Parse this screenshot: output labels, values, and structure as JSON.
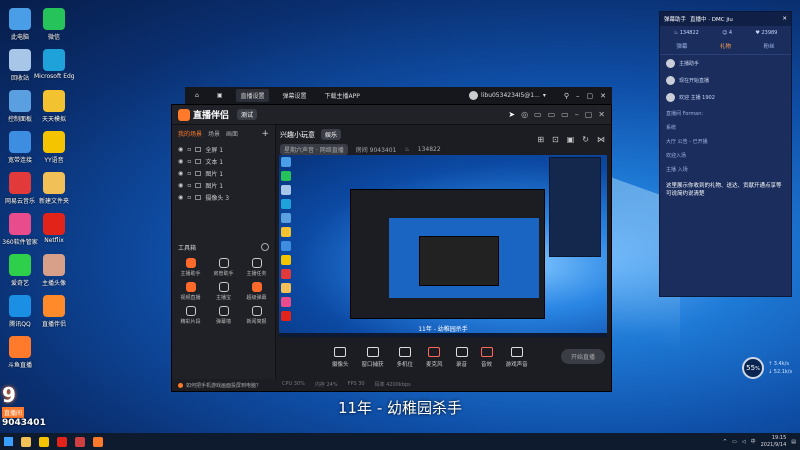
{
  "desktop_icons": [
    {
      "label": "此电脑",
      "color": "#4a9ee8"
    },
    {
      "label": "微信",
      "color": "#25c35a"
    },
    {
      "label": "回收站",
      "color": "#a8c6e8"
    },
    {
      "label": "Microsoft Edge",
      "color": "#1fa2d9"
    },
    {
      "label": "控制面板",
      "color": "#5aa0e0"
    },
    {
      "label": "天天模拟",
      "color": "#f2c230"
    },
    {
      "label": "宽带连接",
      "color": "#3d8de0"
    },
    {
      "label": "YY语音",
      "color": "#f5c400"
    },
    {
      "label": "网易云音乐",
      "color": "#e23a3a"
    },
    {
      "label": "新建文件夹",
      "color": "#f1c056"
    },
    {
      "label": "360软件管家",
      "color": "#e94c8c"
    },
    {
      "label": "Netflix",
      "color": "#e2231a"
    },
    {
      "label": "爱奇艺",
      "color": "#2ecf4a"
    },
    {
      "label": "主播头像",
      "color": "#d9a089"
    },
    {
      "label": "腾讯QQ",
      "color": "#1a8fe3"
    },
    {
      "label": "直播伴侣",
      "color": "#ff8a2a"
    },
    {
      "label": "斗鱼直播",
      "color": "#ff7a2b"
    }
  ],
  "top_bar": {
    "items": [
      "直播设置",
      "弹幕设置",
      "下载主播APP"
    ],
    "user": "libu0534234I5@1..."
  },
  "app": {
    "logo": "直播伴侣",
    "version": "测试",
    "panel_tabs": [
      "我的场景",
      "场景",
      "画面"
    ],
    "sources": [
      "全屏 1",
      "文本 1",
      "图片 1",
      "图片 1",
      "摄像头 3"
    ],
    "tools_title": "工具箱",
    "tools": [
      {
        "label": "主播助手",
        "hot": true
      },
      {
        "label": "房管助手",
        "hot": false
      },
      {
        "label": "主播任务",
        "hot": false
      },
      {
        "label": "视频直播",
        "hot": true
      },
      {
        "label": "主播宝",
        "hot": false
      },
      {
        "label": "超级弹幕",
        "hot": true
      },
      {
        "label": "精彩片段",
        "hot": false
      },
      {
        "label": "弹幕墙",
        "hot": false
      },
      {
        "label": "新闻简报",
        "hot": false
      }
    ],
    "tip": "如何把手机游戏画面投屏到电脑？",
    "room_title": "兴趣小玩意",
    "room_tag": "娱乐",
    "meta_category": "星期六声音 · 网络直播",
    "meta_room": "房间 9043401",
    "meta_hot": "134822",
    "controls": [
      "摄像头",
      "窗口捕获",
      "多机位",
      "麦克风",
      "录音",
      "音效",
      "游戏声音"
    ],
    "start_button": "开始直播",
    "status": [
      "CPU 30%",
      "内存 24%",
      "FPS 30",
      "码率 4200kbps"
    ],
    "stage_caption": "11年 - 幼稚园杀手"
  },
  "chat": {
    "title": "弹幕助手",
    "room": "直播中 · DMC jiu",
    "stats": [
      "134822",
      "4",
      "23989"
    ],
    "tabs": [
      "弹幕",
      "礼物",
      "粉丝"
    ],
    "messages": [
      {
        "name": "主播助手"
      },
      {
        "name": "现在开始直播"
      },
      {
        "name": "欢迎 主播 1902"
      }
    ],
    "lines": [
      "直播间 Forman:",
      "系统",
      "大厅 公告 - 已开播",
      "欢迎入场",
      "主播 入场"
    ],
    "notice": "这里展示你收到的礼物、送达、贡献开通点享等可说简约说清楚"
  },
  "speed": {
    "value": "55",
    "unit": "%",
    "up": "3.4k/s",
    "down": "52.1k/s"
  },
  "subtitle": "11年 - 幼稚园杀手",
  "watermark": {
    "logo": "9",
    "tag": "直播间",
    "number": "9043401"
  },
  "clock": {
    "time": "19:15",
    "date": "2021/9/14"
  }
}
